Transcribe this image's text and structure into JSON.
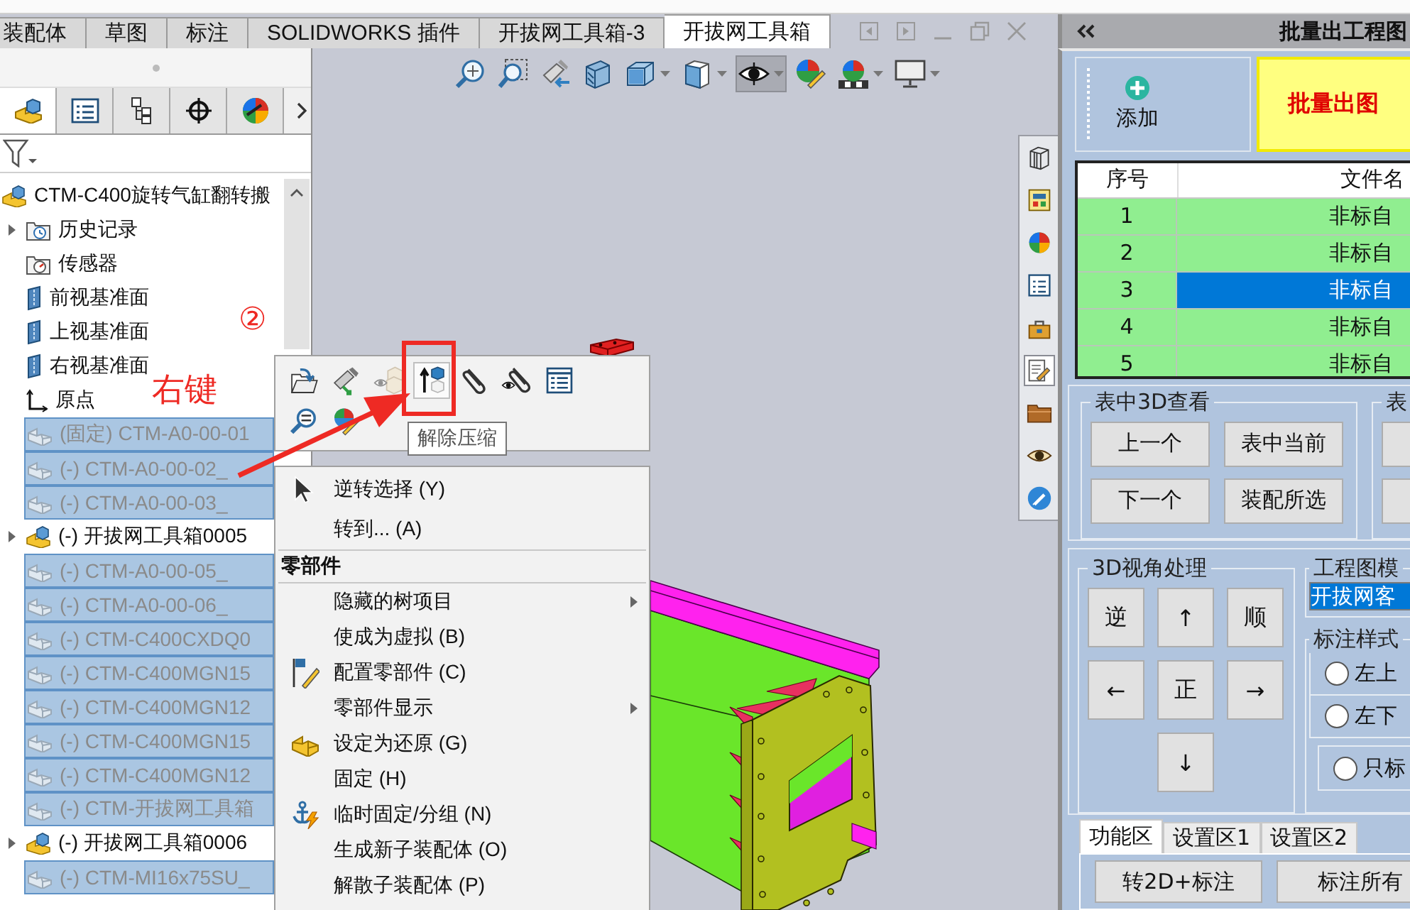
{
  "document_tabs": [
    {
      "label": "装配体",
      "selected": false
    },
    {
      "label": "草图",
      "selected": false
    },
    {
      "label": "标注",
      "selected": false
    },
    {
      "label": "SOLIDWORKS 插件",
      "selected": false
    },
    {
      "label": "开拔网工具箱-3",
      "selected": false
    },
    {
      "label": "开拔网工具箱",
      "selected": true
    }
  ],
  "feature_manager": {
    "tabs": [
      {
        "kind": "feature-tree",
        "selected": true
      },
      {
        "kind": "properties",
        "selected": false
      },
      {
        "kind": "configurations",
        "selected": false
      },
      {
        "kind": "dimxpert",
        "selected": false
      },
      {
        "kind": "display",
        "selected": false
      }
    ],
    "tree": {
      "kind": "assembly",
      "label": "CTM-C400旋转气缸翻转搬",
      "selected": false,
      "suppressed": false,
      "children": [
        {
          "kind": "history",
          "label": "历史记录",
          "expanded": false,
          "selected": false,
          "suppressed": false
        },
        {
          "kind": "sensors",
          "label": "传感器",
          "selected": false,
          "suppressed": false
        },
        {
          "kind": "plane",
          "label": "前视基准面",
          "selected": false,
          "suppressed": false
        },
        {
          "kind": "plane",
          "label": "上视基准面",
          "selected": false,
          "suppressed": false
        },
        {
          "kind": "plane",
          "label": "右视基准面",
          "selected": false,
          "suppressed": false
        },
        {
          "kind": "origin",
          "label": "原点",
          "selected": false,
          "suppressed": false
        },
        {
          "kind": "part",
          "label": "(固定) CTM-A0-00-01",
          "selected": true,
          "suppressed": true
        },
        {
          "kind": "part",
          "label": "(-) CTM-A0-00-02_",
          "selected": true,
          "suppressed": true
        },
        {
          "kind": "part",
          "label": "(-) CTM-A0-00-03_",
          "selected": true,
          "suppressed": true
        },
        {
          "kind": "assembly",
          "label": "(-) 开拔网工具箱0005",
          "expanded": false,
          "selected": false,
          "suppressed": false
        },
        {
          "kind": "part",
          "label": "(-) CTM-A0-00-05_",
          "selected": true,
          "suppressed": true
        },
        {
          "kind": "part",
          "label": "(-) CTM-A0-00-06_",
          "selected": true,
          "suppressed": true
        },
        {
          "kind": "part",
          "label": "(-) CTM-C400CXDQ0",
          "selected": true,
          "suppressed": true
        },
        {
          "kind": "part",
          "label": "(-) CTM-C400MGN15",
          "selected": true,
          "suppressed": true
        },
        {
          "kind": "part",
          "label": "(-) CTM-C400MGN12",
          "selected": true,
          "suppressed": true
        },
        {
          "kind": "part",
          "label": "(-) CTM-C400MGN15",
          "selected": true,
          "suppressed": true
        },
        {
          "kind": "part",
          "label": "(-) CTM-C400MGN12",
          "selected": true,
          "suppressed": true
        },
        {
          "kind": "part",
          "label": "(-) CTM-开拔网工具箱",
          "selected": true,
          "suppressed": true
        },
        {
          "kind": "assembly",
          "label": "(-) 开拔网工具箱0006",
          "expanded": false,
          "selected": false,
          "suppressed": false
        },
        {
          "kind": "part",
          "label": "(-) CTM-MI16x75SU_",
          "selected": true,
          "suppressed": true
        }
      ]
    }
  },
  "view_toolbar": [
    {
      "kind": "zoom-fit",
      "dropdown": false,
      "pressed": false
    },
    {
      "kind": "zoom-area",
      "dropdown": false,
      "pressed": false
    },
    {
      "kind": "previous-view",
      "dropdown": false,
      "pressed": false
    },
    {
      "kind": "section-view",
      "dropdown": false,
      "pressed": false
    },
    {
      "kind": "view-orientation",
      "dropdown": true,
      "pressed": false
    },
    {
      "kind": "display-style",
      "dropdown": true,
      "pressed": false
    },
    {
      "kind": "hide-show",
      "dropdown": true,
      "pressed": true
    },
    {
      "kind": "edit-appearance",
      "dropdown": false,
      "pressed": false
    },
    {
      "kind": "scenes",
      "dropdown": true,
      "pressed": false
    },
    {
      "kind": "view-settings",
      "dropdown": true,
      "pressed": false
    }
  ],
  "task_pane": [
    {
      "kind": "resources",
      "selected": false
    },
    {
      "kind": "design-library",
      "selected": false
    },
    {
      "kind": "appearances",
      "selected": false
    },
    {
      "kind": "custom-properties",
      "selected": false
    },
    {
      "kind": "toolbox",
      "selected": false
    },
    {
      "kind": "drawing-tool",
      "selected": true
    },
    {
      "kind": "file-explorer",
      "selected": false
    },
    {
      "kind": "view-palette",
      "selected": false
    },
    {
      "kind": "link",
      "selected": false
    }
  ],
  "context_toolbar": {
    "buttons": [
      {
        "kind": "open-part",
        "hovered": false,
        "disabled": false
      },
      {
        "kind": "isolate",
        "hovered": false,
        "disabled": false
      },
      {
        "kind": "hide",
        "hovered": false,
        "disabled": true
      },
      {
        "kind": "unsuppress",
        "hovered": true,
        "disabled": false
      },
      {
        "kind": "mates",
        "hovered": false,
        "disabled": false
      },
      {
        "kind": "view-mates",
        "hovered": false,
        "disabled": false
      },
      {
        "kind": "properties",
        "hovered": false,
        "disabled": false
      },
      {
        "kind": "zoom-selection",
        "hovered": false,
        "disabled": false
      },
      {
        "kind": "appearance",
        "hovered": false,
        "disabled": false
      }
    ],
    "tooltip": "解除压缩"
  },
  "context_menu": {
    "items": [
      {
        "kind": "cursor",
        "label": "逆转选择 (Y)",
        "submenu": false
      },
      {
        "kind": "plain",
        "label": "转到... (A)",
        "submenu": false
      }
    ],
    "section": {
      "title": "零部件",
      "items": [
        {
          "kind": "plain",
          "label": "隐藏的树项目",
          "submenu": true
        },
        {
          "kind": "plain",
          "label": "使成为虚拟 (B)",
          "submenu": false
        },
        {
          "kind": "configure",
          "label": "配置零部件 (C)",
          "submenu": false
        },
        {
          "kind": "plain",
          "label": "零部件显示",
          "submenu": true
        },
        {
          "kind": "resolve",
          "label": "设定为还原 (G)",
          "submenu": false
        },
        {
          "kind": "plain",
          "label": "固定 (H)",
          "submenu": false
        },
        {
          "kind": "float",
          "label": "临时固定/分组 (N)",
          "submenu": false
        },
        {
          "kind": "plain",
          "label": "生成新子装配体 (O)",
          "submenu": false
        },
        {
          "kind": "plain",
          "label": "解散子装配体 (P)",
          "submenu": false
        }
      ]
    }
  },
  "annotations": {
    "step": "②",
    "callout": "右键"
  },
  "batch_panel": {
    "title": "批量出工程图",
    "add_button": "添加",
    "batch_button": "批量出图",
    "table": {
      "columns": [
        "序号",
        "文件名"
      ],
      "rows": [
        {
          "number": "1",
          "file_name": "非标自",
          "selected": false
        },
        {
          "number": "2",
          "file_name": "非标自",
          "selected": false
        },
        {
          "number": "3",
          "file_name": "非标自",
          "selected": true
        },
        {
          "number": "4",
          "file_name": "非标自",
          "selected": false
        },
        {
          "number": "5",
          "file_name": "非标自",
          "selected": false
        }
      ]
    },
    "view_group": {
      "title": "表中3D查看",
      "buttons": [
        "上一个",
        "表中当前",
        "下一个",
        "装配所选"
      ]
    },
    "view_group_2": {
      "title": "表"
    },
    "angle_group": {
      "title": "3D视角处理",
      "buttons": [
        "逆",
        "↑",
        "顺",
        "←",
        "正",
        "→",
        "↓"
      ]
    },
    "template_group": {
      "title": "工程图模",
      "value": "开拔网客",
      "highlighted": true
    },
    "annotation_group": {
      "title": "标注样式",
      "options": [
        {
          "kind": "plain",
          "label": "左上",
          "selected": false
        },
        {
          "kind": "plain",
          "label": "左下",
          "selected": false
        },
        {
          "kind": "boxed",
          "label": "只标",
          "selected": false
        }
      ]
    },
    "tabs": [
      {
        "label": "功能区",
        "selected": true
      },
      {
        "label": "设置区1",
        "selected": false
      },
      {
        "label": "设置区2",
        "selected": false
      }
    ],
    "bottom_buttons": [
      "转2D+标注",
      "标注所有"
    ]
  }
}
